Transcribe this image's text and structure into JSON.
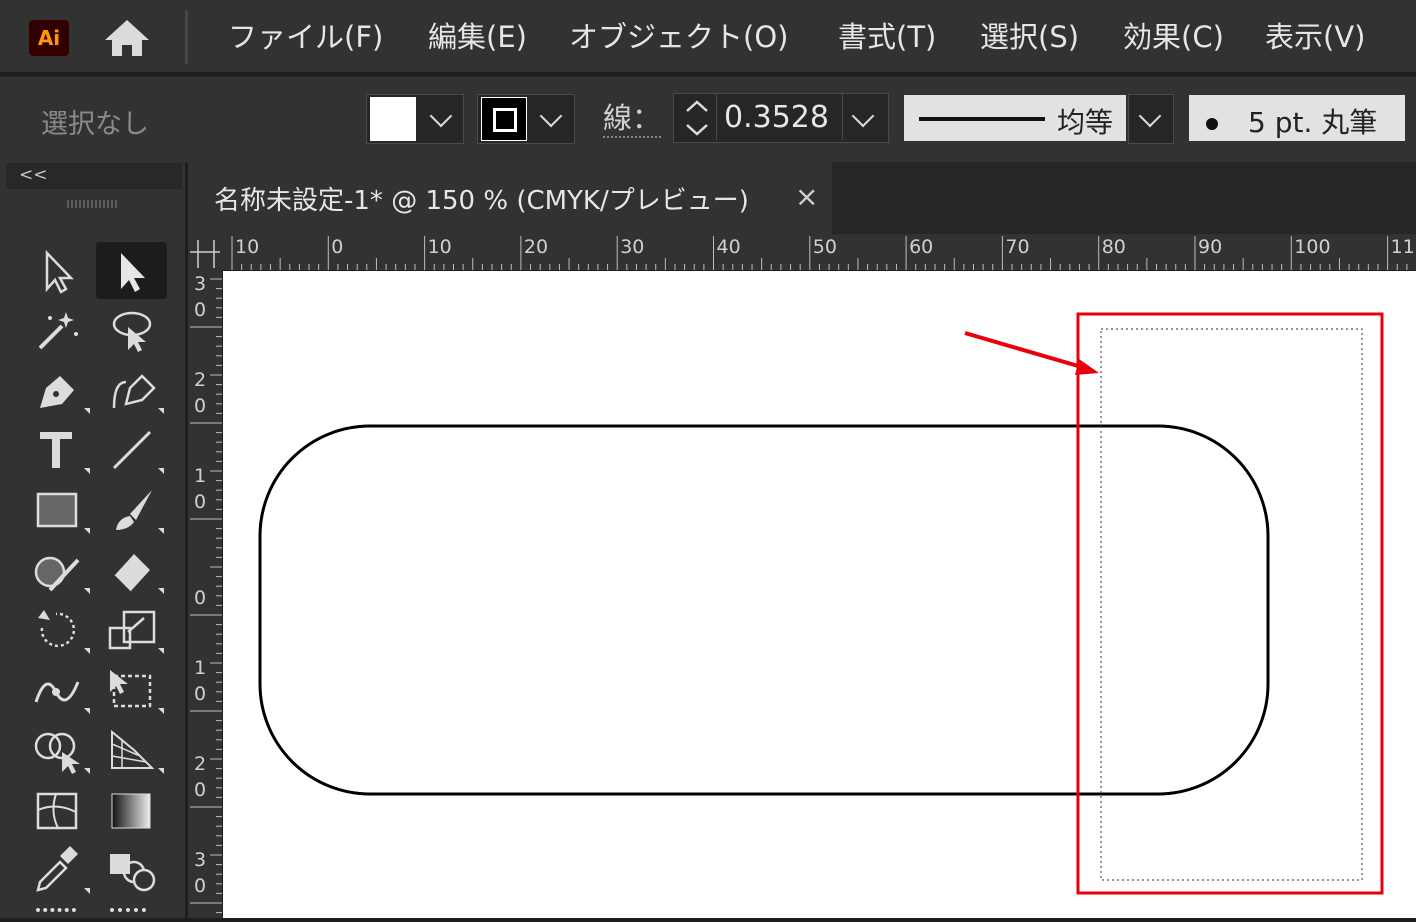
{
  "app": {
    "logo_text": "Ai",
    "accent": "#ff9a00"
  },
  "menu": {
    "items": [
      {
        "label": "ファイル(F)"
      },
      {
        "label": "編集(E)"
      },
      {
        "label": "オブジェクト(O)"
      },
      {
        "label": "書式(T)"
      },
      {
        "label": "選択(S)"
      },
      {
        "label": "効果(C)"
      },
      {
        "label": "表示(V)"
      }
    ]
  },
  "control_bar": {
    "selection_state": "選択なし",
    "stroke_label": "線：",
    "stroke_weight": "0.3528",
    "stroke_profile": "均等",
    "brush": "5 pt. 丸筆"
  },
  "toolbar": {
    "collapse_label": "<<"
  },
  "document": {
    "tab_title": "名称未設定-1* @ 150 % (CMYK/プレビュー)",
    "close_label": "×"
  },
  "rulers": {
    "top_labels": [
      "10",
      "0",
      "10",
      "20",
      "30",
      "40",
      "50",
      "60",
      "70",
      "80",
      "90",
      "100",
      "11"
    ],
    "left_labels": [
      "30",
      "20",
      "10",
      "0",
      "10",
      "20",
      "30"
    ]
  },
  "annotation": {
    "highlight_color": "#e8000b",
    "arrow_color": "#e8000b"
  }
}
